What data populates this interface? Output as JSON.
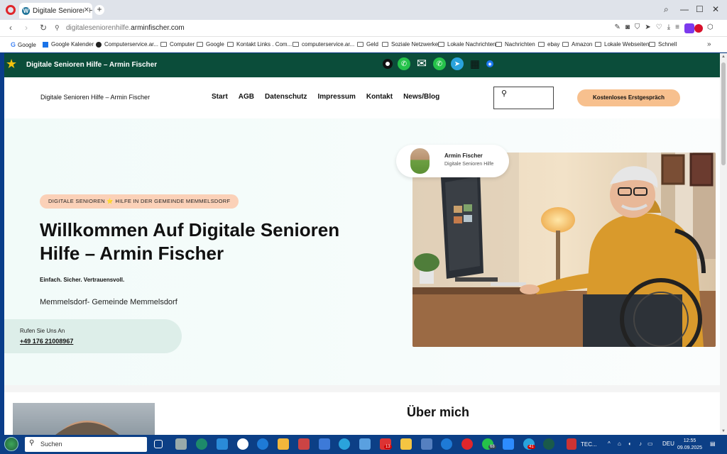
{
  "browser": {
    "tab_title": "Digitale Senioren Hilfe – A",
    "url_prefix": "digitaleseniorenhilfe.",
    "url_domain": "arminfischer.com"
  },
  "bookmarks": [
    {
      "label": "Google",
      "icon": "google-icon"
    },
    {
      "label": "Google Kalender",
      "icon": "calendar-icon"
    },
    {
      "label": "Computerservice.ar...",
      "icon": "circle-icon"
    },
    {
      "label": "Computer",
      "icon": "folder-icon"
    },
    {
      "label": "Google",
      "icon": "folder-icon"
    },
    {
      "label": "Kontakt Links . Com...",
      "icon": "folder-icon"
    },
    {
      "label": "computerservice.ar...",
      "icon": "folder-icon"
    },
    {
      "label": "Geld",
      "icon": "folder-icon"
    },
    {
      "label": "Soziale Netzwerke",
      "icon": "folder-icon"
    },
    {
      "label": "Lokale Nachrichten",
      "icon": "folder-icon"
    },
    {
      "label": "Nachrichten",
      "icon": "folder-icon"
    },
    {
      "label": "ebay",
      "icon": "folder-icon"
    },
    {
      "label": "Amazon",
      "icon": "folder-icon"
    },
    {
      "label": "Lokale Webseiten",
      "icon": "folder-icon"
    },
    {
      "label": "Schnell",
      "icon": "folder-icon"
    }
  ],
  "site": {
    "topbar_title": "Digitale Senioren Hilfe – Armin Fischer",
    "name": "Digitale Senioren Hilfe – Armin Fischer",
    "nav": [
      "Start",
      "AGB",
      "Datenschutz",
      "Impressum",
      "Kontakt",
      "News/Blog"
    ],
    "cta": "Kostenloses Erstgespräch",
    "accent": "#0b4d3a",
    "cta_color": "#f7c08e"
  },
  "hero": {
    "badge": "DIGITALE SENIOREN ⭐ HILFE IN DER GEMEINDE MEMMELSDORF",
    "title": "Willkommen Auf Digitale Senioren Hilfe – Armin Fischer",
    "tagline": "Einfach. Sicher. Vertrauensvoll.",
    "location": "Memmelsdorf- Gemeinde Memmelsdorf",
    "phone_label": "Rufen Sie Uns An",
    "phone": "+49 176 21008967",
    "profile_name": "Armin Fischer",
    "profile_sub": "Digitale Senioren Hilfe"
  },
  "about": {
    "title": "Über mich"
  },
  "taskbar": {
    "search": "Suchen",
    "tec_label": "TEC...",
    "lang": "DEU",
    "time": "12:55",
    "date": "09.09.2025",
    "badges": {
      "a": "13",
      "b": "68",
      "c": "41"
    }
  }
}
